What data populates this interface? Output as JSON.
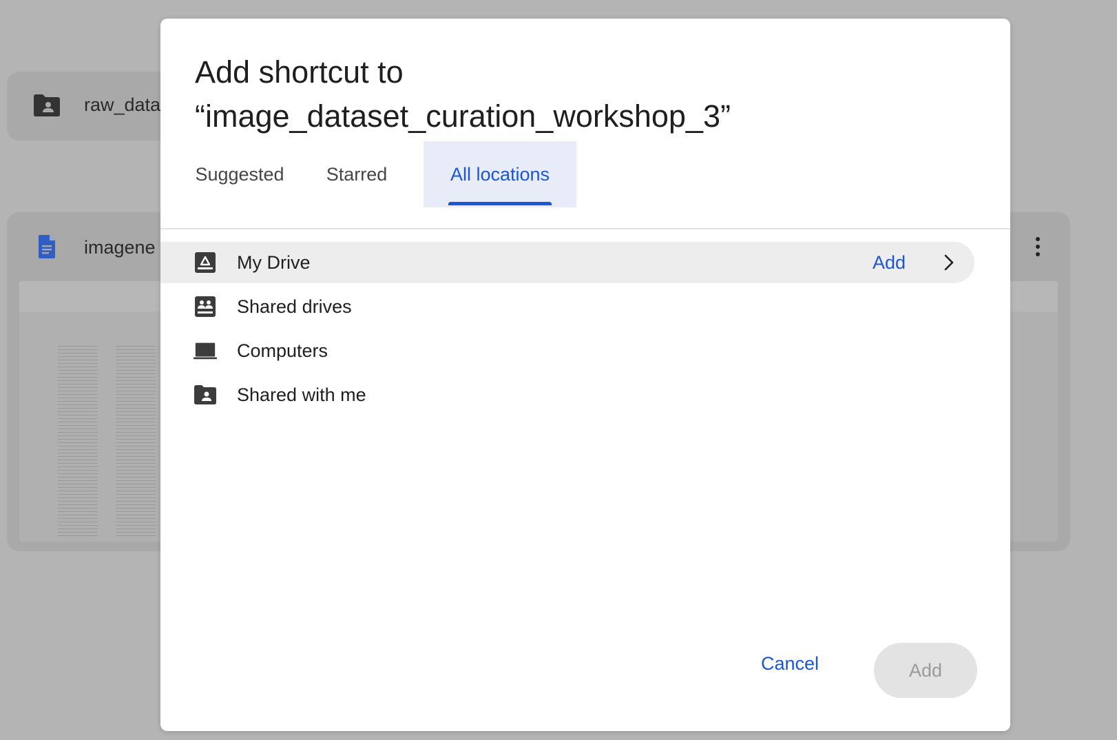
{
  "background": {
    "folder_card": {
      "label": "raw_data",
      "icon": "shared-folder-icon"
    },
    "doc_card": {
      "label": "imagene",
      "icon": "google-doc-icon",
      "menu_icon": "more-vert-icon"
    }
  },
  "dialog": {
    "title_line1": "Add shortcut to",
    "title_line2": "“image_dataset_curation_workshop_3”",
    "tabs": [
      {
        "label": "Suggested",
        "active": false
      },
      {
        "label": "Starred",
        "active": false
      },
      {
        "label": "All locations",
        "active": true
      }
    ],
    "locations": [
      {
        "label": "My Drive",
        "icon": "drive-icon",
        "selected": true,
        "action_label": "Add"
      },
      {
        "label": "Shared drives",
        "icon": "shared-drives-icon",
        "selected": false
      },
      {
        "label": "Computers",
        "icon": "laptop-icon",
        "selected": false
      },
      {
        "label": "Shared with me",
        "icon": "shared-folder-icon",
        "selected": false
      }
    ],
    "buttons": {
      "cancel_label": "Cancel",
      "add_label": "Add",
      "add_disabled": true
    }
  },
  "colors": {
    "accent": "#1a56d6",
    "active_tab_bg": "#e8ecf8",
    "selected_row_bg": "#ededed",
    "overlay": "#b4b4b4"
  }
}
